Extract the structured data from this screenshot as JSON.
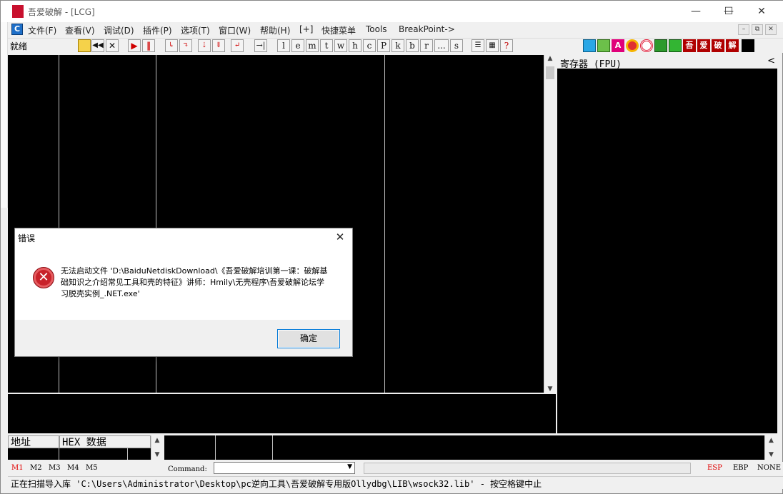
{
  "window": {
    "title": "吾爱破解 - [LCG]",
    "logo_text": "吾爱破解",
    "minimize_glyph": "—",
    "maximize_glyph": "☐",
    "close_glyph": "✕"
  },
  "menu": {
    "items": [
      "文件(F)",
      "查看(V)",
      "调试(D)",
      "插件(P)",
      "选项(T)",
      "窗口(W)",
      "帮助(H)",
      "[+]",
      "快捷菜单",
      "Tools",
      "BreakPoint->"
    ],
    "mdi_buttons": [
      "–",
      "⧉",
      "✕"
    ]
  },
  "toolbar": {
    "status": "就绪",
    "letter_buttons": [
      "l",
      "e",
      "m",
      "t",
      "w",
      "h",
      "c",
      "P",
      "k",
      "b",
      "r",
      "...",
      "s"
    ],
    "plugin_buttons": [
      {
        "text": "A",
        "color": "#e0007a"
      },
      {
        "text": "吾",
        "color": "#b00000"
      },
      {
        "text": "爱",
        "color": "#b00000"
      },
      {
        "text": "破",
        "color": "#b00000"
      },
      {
        "text": "解",
        "color": "#b00000"
      }
    ]
  },
  "registers": {
    "header": "寄存器 (FPU)",
    "collapse_glyph": "<"
  },
  "dump": {
    "address_label": "地址",
    "hex_label": "HEX 数据"
  },
  "command_bar": {
    "marks": [
      "M1",
      "M2",
      "M3",
      "M4",
      "M5"
    ],
    "command_label": "Command:",
    "dropdown_glyph": "▼",
    "registers": [
      "ESP",
      "EBP",
      "NONE"
    ]
  },
  "status_bar": {
    "text": "正在扫描导入库 'C:\\Users\\Administrator\\Desktop\\pc逆向工具\\吾爱破解专用版Ollydbg\\LIB\\wsock32.lib' - 按空格键中止"
  },
  "dialog": {
    "title": "错误",
    "close_glyph": "✕",
    "icon_glyph": "✕",
    "message": "无法启动文件 'D:\\BaiduNetdiskDownload\\《吾爱破解培训第一课：破解基础知识之介绍常见工具和壳的特征》讲师：Hmily\\无壳程序\\吾爱破解论坛学习脱壳实例_.NET.exe'",
    "ok_label": "确定"
  },
  "colors": {
    "pane_bg": "#000000",
    "accent_red": "#c8102e",
    "mark_active": "#e00000"
  }
}
